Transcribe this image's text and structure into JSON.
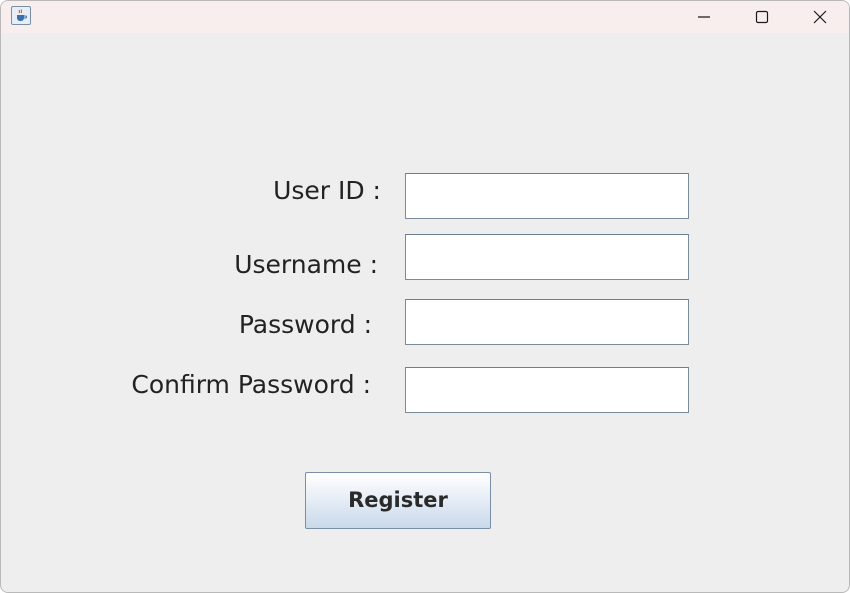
{
  "window": {
    "icon": "java-cup-icon",
    "controls": {
      "minimize_icon": "minimize-icon",
      "maximize_icon": "maximize-icon",
      "close_icon": "close-icon"
    }
  },
  "form": {
    "user_id_label": "User ID :",
    "user_id_value": "",
    "username_label": "Username :",
    "username_value": "",
    "password_label": "Password :",
    "password_value": "",
    "confirm_password_label": "Confirm Password :",
    "confirm_password_value": ""
  },
  "actions": {
    "register_label": "Register"
  },
  "colors": {
    "titlebar": "#f9eeee",
    "background": "#eeeeee",
    "button_gradient_bottom": "#c9d9ea"
  }
}
